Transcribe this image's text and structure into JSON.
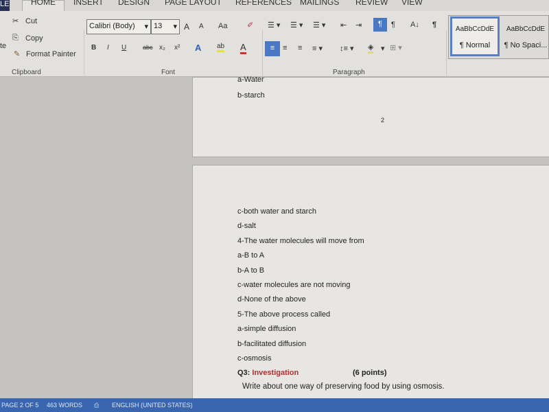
{
  "tabs": [
    "LE",
    "HOME",
    "INSERT",
    "DESIGN",
    "PAGE LAYOUT",
    "REFERENCES",
    "MAILINGS",
    "REVIEW",
    "VIEW"
  ],
  "clipboard": {
    "paste_fragment": "te",
    "cut": "Cut",
    "copy": "Copy",
    "format_painter": "Format Painter",
    "group": "Clipboard"
  },
  "font": {
    "name": "Calibri (Body)",
    "size": "13",
    "change_case": "Aa",
    "group": "Font",
    "bold": "B",
    "italic": "I",
    "underline": "U",
    "strike": "abc",
    "subscript": "x₂",
    "superscript": "x²",
    "text_effects": "A",
    "highlight": "ab",
    "font_color": "A",
    "grow": "A",
    "shrink": "A"
  },
  "paragraph": {
    "group": "Paragraph",
    "pilcrow": "¶",
    "sort": "A↓"
  },
  "styles": [
    {
      "preview": "AaBbCcDdE",
      "name": "¶ Normal"
    },
    {
      "preview": "AaBbCcDdE",
      "name": "¶ No Spaci..."
    }
  ],
  "colors": {
    "status_bar": "#3a66b0",
    "accent_red": "#b03030",
    "highlight_yellow": "#e8e040",
    "font_red": "#d03030"
  },
  "document": {
    "page1_lines": [
      "a-Water",
      "b-starch"
    ],
    "page1_number": "2",
    "page2_lines": [
      "c-both water and starch",
      "d-salt",
      "4-The water molecules will move from",
      "a-B to A",
      "b-A to B",
      "c-water molecules are not moving",
      "d-None of the above",
      "5-The above process called",
      "a-simple diffusion",
      "b-facilitated diffusion",
      "c-osmosis"
    ],
    "q3_label": "Q3: ",
    "q3_title": "Investigation",
    "q3_points": "(6 points)",
    "q3_prompt": "Write about one way of preserving food by using osmosis."
  },
  "status": {
    "page": "PAGE 2 OF 5",
    "words": "463 WORDS",
    "language": "ENGLISH (UNITED STATES)"
  }
}
